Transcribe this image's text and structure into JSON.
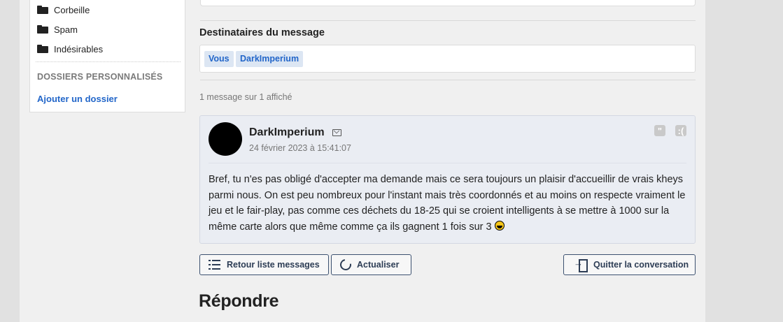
{
  "sidebar": {
    "folders": [
      "Corbeille",
      "Spam",
      "Indésirables"
    ],
    "custom_heading": "DOSSIERS PERSONNALISÉS",
    "add_folder": "Ajouter un dossier"
  },
  "recipients": {
    "title": "Destinataires du message",
    "tags": [
      "Vous",
      "DarkImperium"
    ]
  },
  "message_count": "1 message sur 1 affiché",
  "message": {
    "author": "DarkImperium",
    "date": "24 février 2023 à 15:41:07",
    "body": "Bref, tu n'es pas obligé d'accepter ma demande mais ce sera toujours un plaisir d'accueillir de vrais kheys parmi nous. On est peu nombreux pour l'instant mais très coordonnés et au moins on respecte vraiment le jeu et le fair-play, pas comme ces déchets du 18-25 qui se croient intelligents à se mettre à 1000 sur la même carte alors que même comme ça ils gagnent 1 fois sur 3",
    "quote_icon": "quote-icon",
    "report_icon": "report-icon"
  },
  "actions": {
    "back": "Retour liste messages",
    "refresh": "Actualiser",
    "leave": "Quitter la conversation"
  },
  "reply_title": "Répondre",
  "colors": {
    "link": "#2266c9",
    "button_border": "#3c5170",
    "message_bg": "#eaedf3"
  }
}
